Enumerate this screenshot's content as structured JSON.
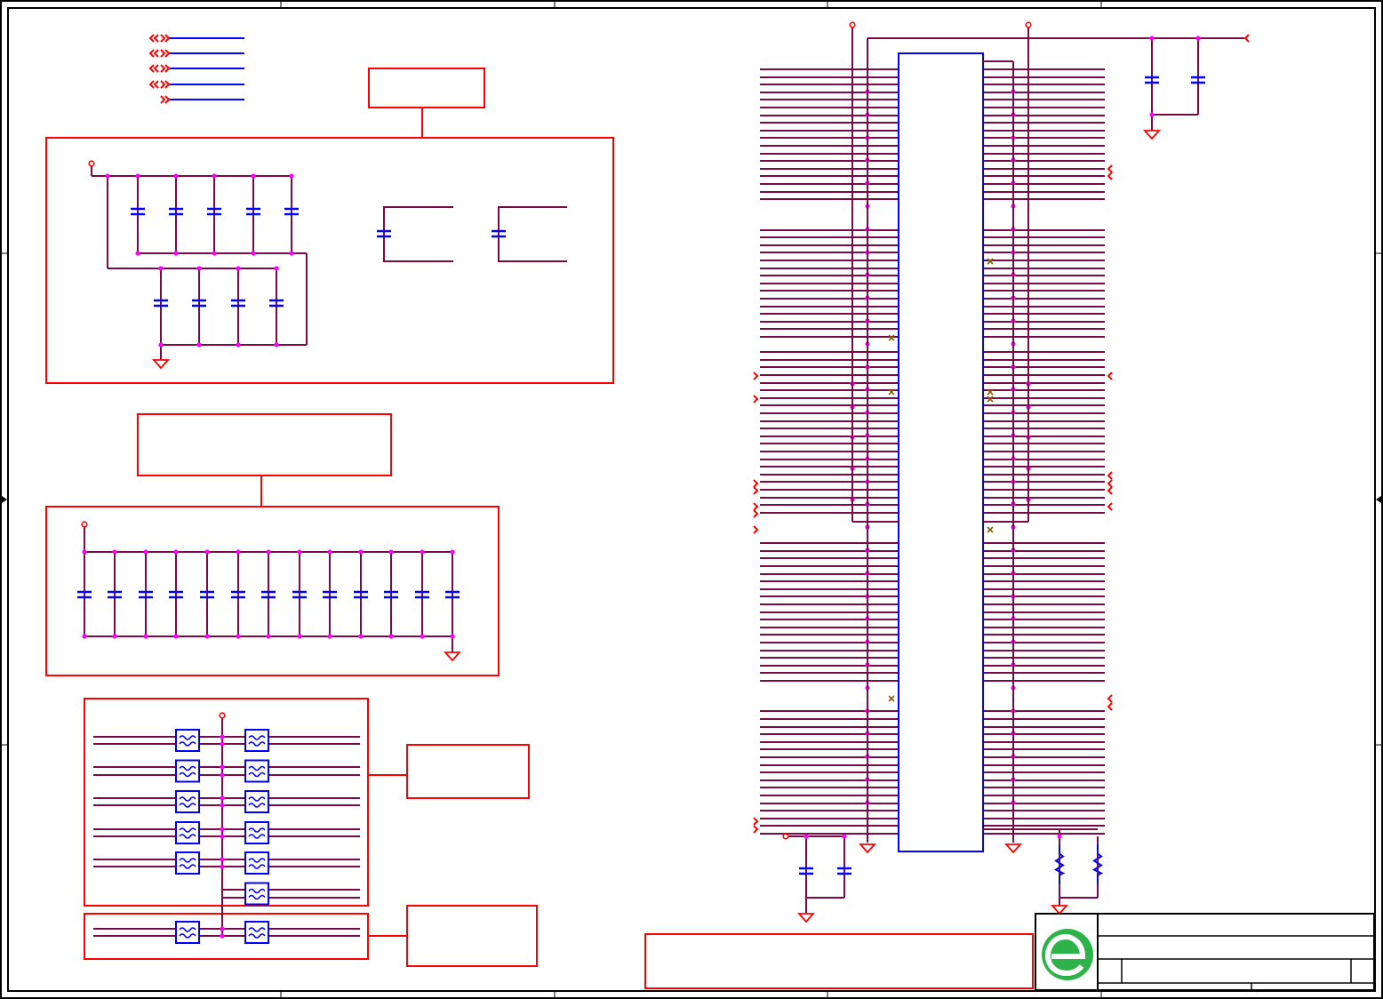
{
  "sheet": {
    "border_color": "#000000",
    "wire_color": "#7a0a45",
    "junction_color": "#ff00ff",
    "component_color": "#0000ff",
    "port_color": "#ff0000",
    "box_color": "#ff0000",
    "logo_color": "#2db34a"
  },
  "schematic": {
    "icons": [
      "power-port-icon",
      "ground-symbol-icon",
      "capacitor-icon",
      "resistor-icon",
      "ferrite-bead-icon",
      "offsheet-arrow-icon",
      "no-connect-icon",
      "company-logo-icon"
    ],
    "text_labels": []
  }
}
